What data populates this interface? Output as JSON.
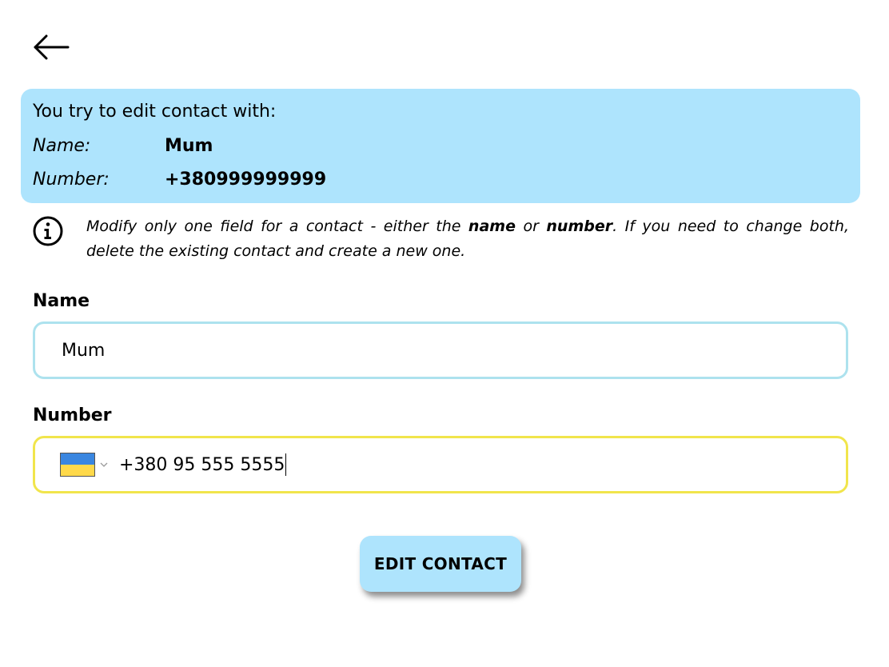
{
  "header": {
    "back_icon": "arrow-left-icon"
  },
  "contact_card": {
    "title": "You try to edit contact with:",
    "name_key": "Name:",
    "name_value": "Mum",
    "number_key": "Number:",
    "number_value": "+380999999999",
    "background_color": "#aee4fd"
  },
  "info": {
    "icon": "info-icon",
    "text_before": "Modify only one field for a contact - either the ",
    "bold_name": "name",
    "text_or": " or ",
    "bold_number": "number",
    "text_after": ". If you need to change both, delete the existing contact and create a new one."
  },
  "form": {
    "name_label": "Name",
    "name_value": "Mum",
    "number_label": "Number",
    "country_flag": "ukraine-flag-icon",
    "number_value": "+380 95 555 5555",
    "name_border_color": "#ade2ee",
    "number_border_color": "#f1e54c"
  },
  "submit": {
    "label": "EDIT CONTACT"
  }
}
